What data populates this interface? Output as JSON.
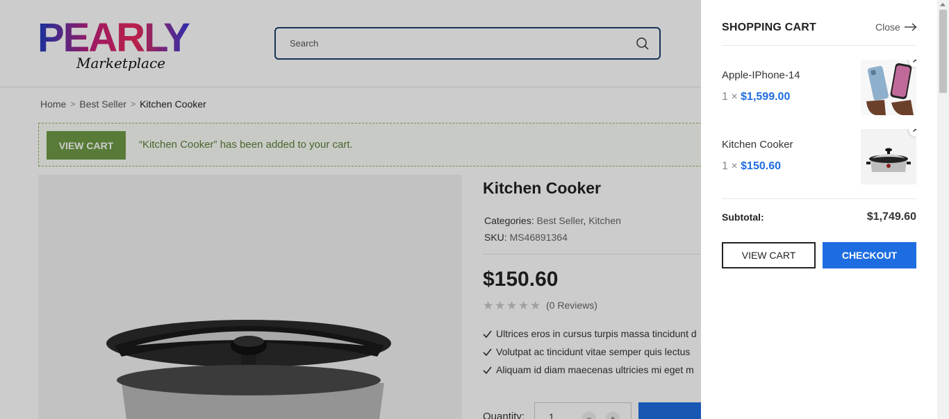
{
  "header": {
    "logo_text": "PEARLY",
    "logo_subtext": "Marketplace",
    "search_placeholder": "Search"
  },
  "breadcrumb": [
    "Home",
    "Best Seller",
    "Kitchen Cooker"
  ],
  "notice": {
    "button_label": "VIEW CART",
    "message": "“Kitchen Cooker” has been added to your cart."
  },
  "product": {
    "title": "Kitchen Cooker",
    "categories_label": "Categories:",
    "categories": [
      "Best Seller",
      "Kitchen"
    ],
    "sku_label": "SKU:",
    "sku": "MS46891364",
    "price": "$150.60",
    "rating": 0,
    "reviews": "(0 Reviews)",
    "features": [
      "Ultrices eros in cursus turpis massa tincidunt d",
      "Volutpat ac tincidunt vitae semper quis lectus",
      "Aliquam id diam maecenas ultricies mi eget m"
    ],
    "quantity_label": "Quantity:",
    "quantity": "1"
  },
  "cart": {
    "title": "SHOPPING CART",
    "close_label": "Close",
    "items": [
      {
        "name": "Apple-IPhone-14",
        "qty": "1",
        "times": "×",
        "price": "$1,599.00",
        "remove": "✕"
      },
      {
        "name": "Kitchen Cooker",
        "qty": "1",
        "times": "×",
        "price": "$150.60",
        "remove": "✕"
      }
    ],
    "subtotal_label": "Subtotal:",
    "subtotal_value": "$1,749.60",
    "view_cart_label": "VIEW CART",
    "checkout_label": "CHECKOUT"
  },
  "colors": {
    "accent": "#1e6de0",
    "notice_green": "#6e9a45",
    "search_border": "#1a3f6e"
  }
}
